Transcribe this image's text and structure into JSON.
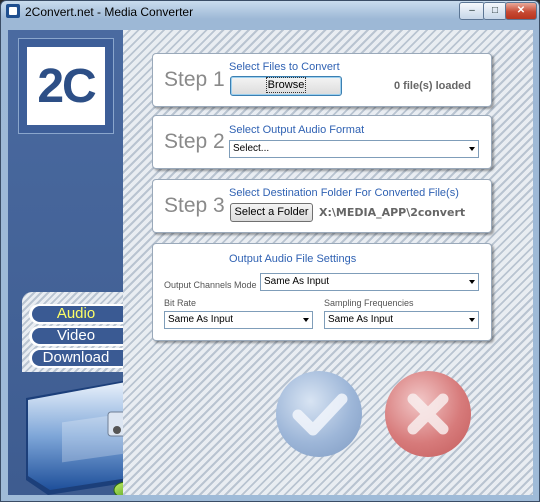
{
  "window": {
    "title": "2Convert.net - Media Converter"
  },
  "logo": {
    "text": "2C"
  },
  "nav": [
    {
      "label": "Audio",
      "active": true
    },
    {
      "label": "Video",
      "active": false
    },
    {
      "label": "Download",
      "active": false
    }
  ],
  "step1": {
    "step_label": "Step 1",
    "caption": "Select Files to Convert",
    "button": "Browse",
    "status": "0 file(s) loaded"
  },
  "step2": {
    "step_label": "Step 2",
    "caption": "Select Output Audio Format",
    "select_value": "Select..."
  },
  "step3": {
    "step_label": "Step 3",
    "caption": "Select Destination Folder For Converted File(s)",
    "button": "Select a Folder",
    "path": "X:\\MEDIA_APP\\2convert"
  },
  "settings": {
    "title": "Output Audio File Settings",
    "channels_label": "Output Channels Mode",
    "channels_value": "Same As Input",
    "bitrate_label": "Bit Rate",
    "bitrate_value": "Same As Input",
    "sampling_label": "Sampling Frequencies",
    "sampling_value": "Same As Input"
  },
  "colors": {
    "accent": "#3062b3",
    "panel_bg": "#46659a",
    "ok": "#8fb0d8",
    "cancel": "#d96060"
  }
}
